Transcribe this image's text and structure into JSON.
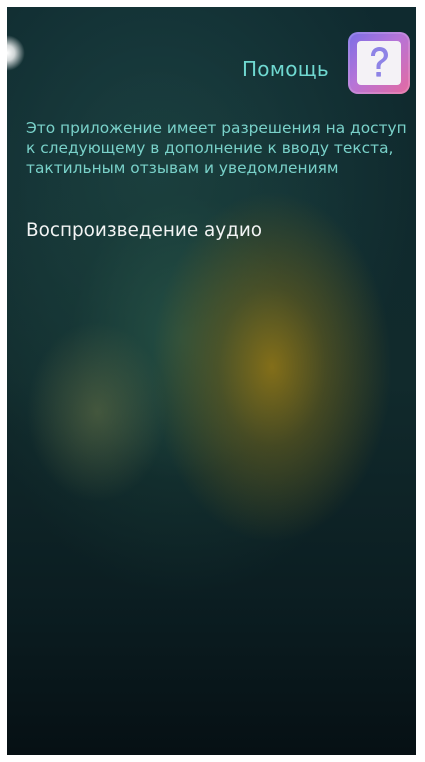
{
  "header": {
    "title": "Помощь",
    "help_icon": "question-mark-icon"
  },
  "content": {
    "description": "Это приложение имеет разрешения на доступ к следующему в дополнение к вводу текста, тактильным отзывам и уведомлениям",
    "permissions": [
      "Воспроизведение аудио"
    ]
  },
  "colors": {
    "accent": "#6fd8d0",
    "text_primary": "#f2f4f4",
    "background": "#0f2a2f"
  }
}
